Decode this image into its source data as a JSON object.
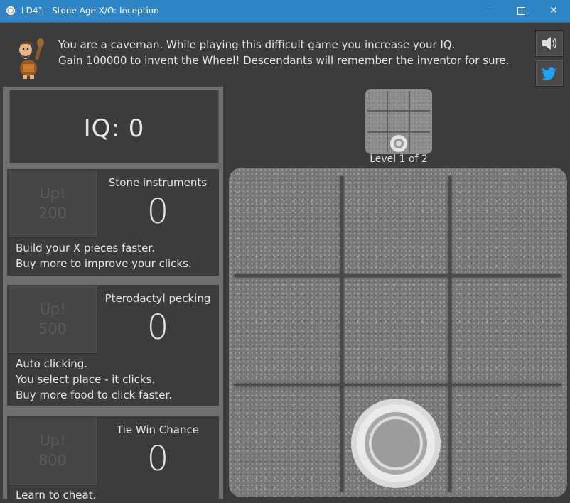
{
  "window": {
    "title": "LD41 - Stone Age X/O: Inception",
    "minimize": "",
    "maximize": "",
    "close": "✕"
  },
  "header": {
    "line1": "You are a caveman. While playing this difficult game you increase your IQ.",
    "line2": "Gain 100000 to invent the Wheel! Descendants will remember the inventor for sure."
  },
  "side_buttons": [
    {
      "icon": "speaker-icon"
    },
    {
      "icon": "twitter-icon"
    }
  ],
  "iq": {
    "label": "IQ: 0"
  },
  "upgrades": [
    {
      "button_label": "Up!",
      "cost": "200",
      "name": "Stone instruments",
      "count": "0",
      "desc": [
        "Build your X pieces faster.",
        "Buy more to improve your clicks."
      ]
    },
    {
      "button_label": "Up!",
      "cost": "500",
      "name": "Pterodactyl pecking",
      "count": "0",
      "desc": [
        "Auto clicking.",
        "You select place - it clicks.",
        "Buy more food to click faster."
      ]
    },
    {
      "button_label": "Up!",
      "cost": "800",
      "name": "Tie Win Chance",
      "count": "0",
      "desc": [
        "Learn to cheat."
      ]
    }
  ],
  "board": {
    "level_text": "Level 1 of 2",
    "cells": [
      "",
      "",
      "",
      "",
      "",
      "",
      "",
      "O",
      ""
    ],
    "mini_cells": [
      "",
      "",
      "",
      "",
      "",
      "",
      "",
      "O",
      ""
    ]
  }
}
